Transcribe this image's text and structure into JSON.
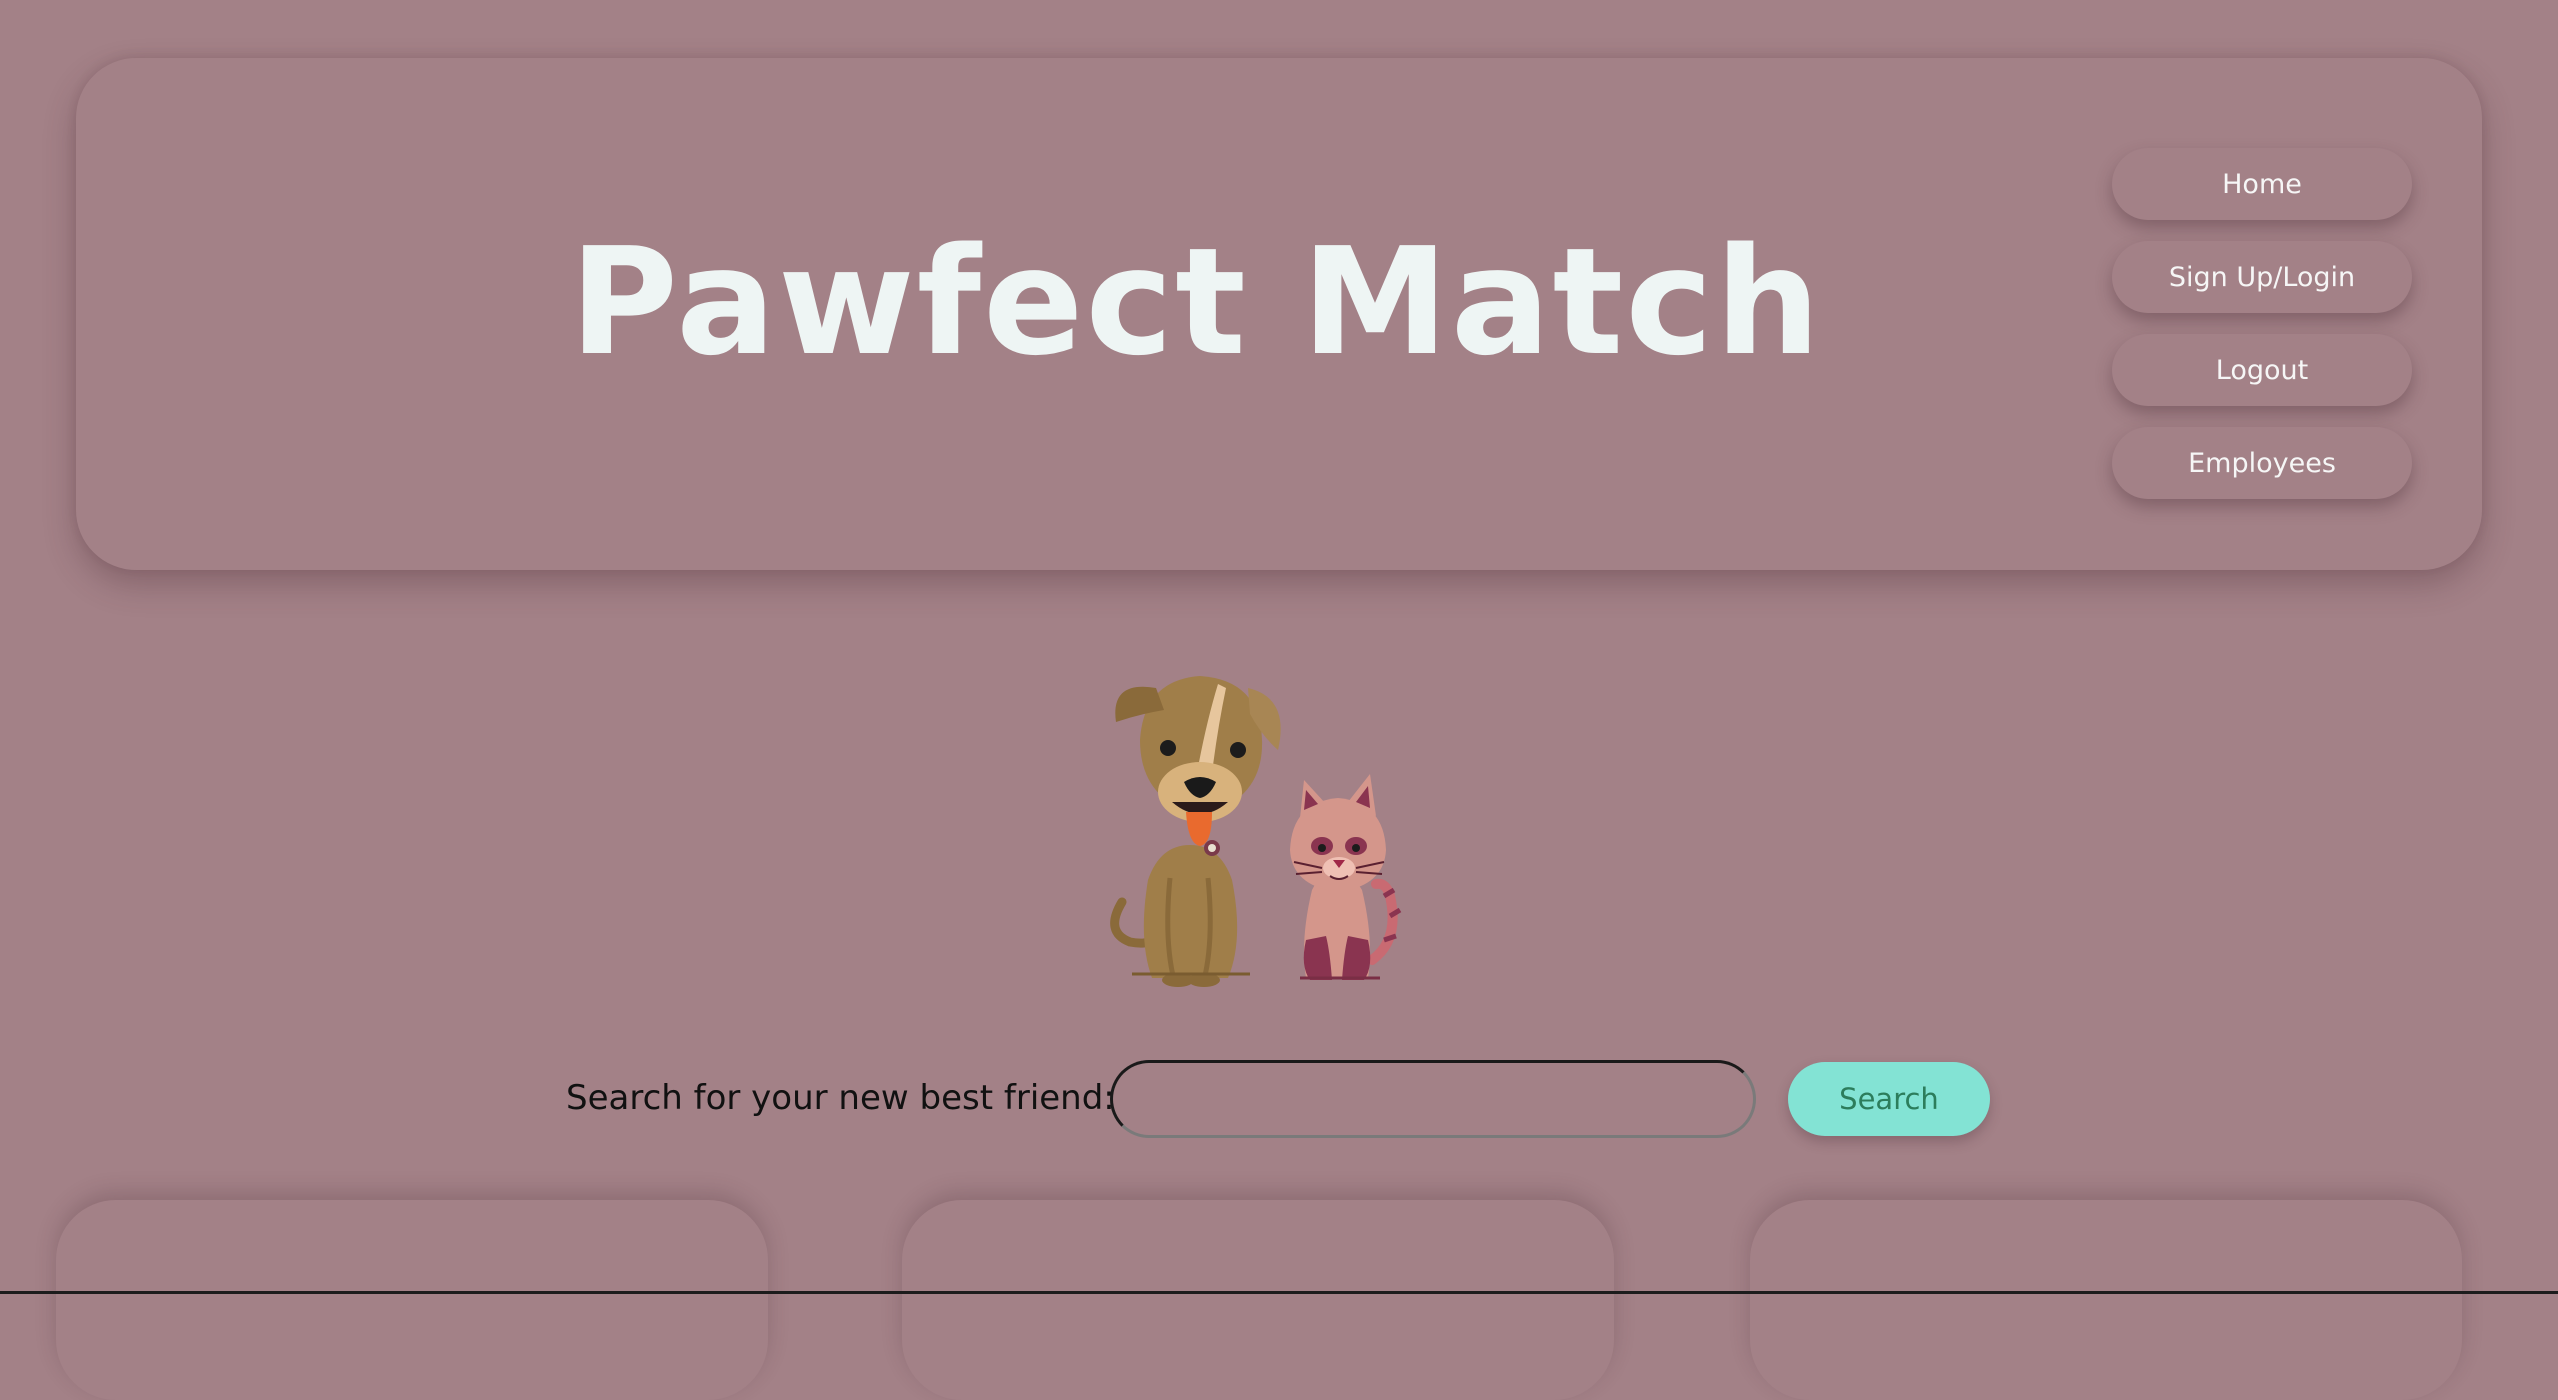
{
  "header": {
    "title": "Pawfect Match"
  },
  "nav": {
    "items": [
      {
        "label": "Home"
      },
      {
        "label": "Sign Up/Login"
      },
      {
        "label": "Logout"
      },
      {
        "label": "Employees"
      }
    ]
  },
  "search": {
    "label": "Search for your new best friend:",
    "value": "",
    "placeholder": "",
    "button_label": "Search"
  },
  "hero": {
    "icon": "dog-and-cat-illustration"
  },
  "colors": {
    "background": "#a38187",
    "title": "#eef5f4",
    "search_button": "#83e3d4",
    "search_button_text": "#2c7d5c"
  }
}
